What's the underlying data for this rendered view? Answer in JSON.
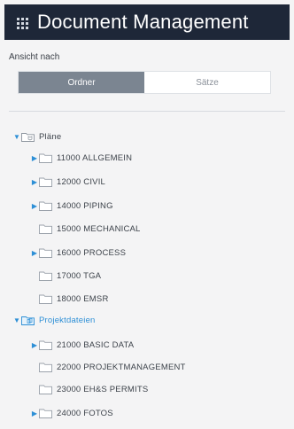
{
  "header": {
    "title": "Document Management",
    "icon": "grid-icon"
  },
  "view": {
    "label": "Ansicht nach",
    "options": [
      {
        "label": "Ordner",
        "active": true
      },
      {
        "label": "Sätze",
        "active": false
      }
    ]
  },
  "tree": {
    "groups": [
      {
        "label": "Pläne",
        "icon": "plans-folder-icon",
        "expanded": true,
        "items": [
          {
            "label": "11000 ALLGEMEIN",
            "expandable": true
          },
          {
            "label": "12000 CIVIL",
            "expandable": true
          },
          {
            "label": "14000 PIPING",
            "expandable": true
          },
          {
            "label": "15000 MECHANICAL",
            "expandable": false
          },
          {
            "label": "16000 PROCESS",
            "expandable": true
          },
          {
            "label": "17000 TGA",
            "expandable": false
          },
          {
            "label": "18000 EMSR",
            "expandable": false
          }
        ]
      },
      {
        "label": "Projektdateien",
        "icon": "project-files-folder-icon",
        "expanded": true,
        "items": [
          {
            "label": "21000 BASIC DATA",
            "expandable": true
          },
          {
            "label": "22000 PROJEKTMANAGEMENT",
            "expandable": false
          },
          {
            "label": "23000 EH&S PERMITS",
            "expandable": false
          },
          {
            "label": "24000 FOTOS",
            "expandable": true
          }
        ]
      }
    ]
  },
  "colors": {
    "header_bg": "#1e2738",
    "accent": "#2d8fd6",
    "active_toggle": "#7b8591"
  }
}
